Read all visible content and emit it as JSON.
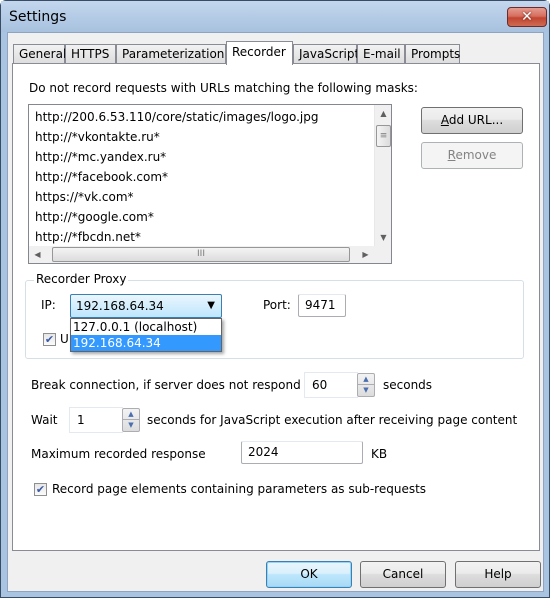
{
  "window": {
    "title": "Settings",
    "close_glyph": "✕"
  },
  "tabs": [
    {
      "label": "General",
      "active": false
    },
    {
      "label": "HTTPS",
      "active": false
    },
    {
      "label": "Parameterization",
      "active": false
    },
    {
      "label": "Recorder",
      "active": true
    },
    {
      "label": "JavaScript",
      "active": false
    },
    {
      "label": "E-mail",
      "active": false
    },
    {
      "label": "Prompts",
      "active": false
    }
  ],
  "recorder": {
    "masks_label": "Do not record requests with URLs matching the following masks:",
    "masks": [
      "http://200.6.53.110/core/static/images/logo.jpg",
      "http://*vkontakte.ru*",
      "http://*mc.yandex.ru*",
      "http://*facebook.com*",
      "https://*vk.com*",
      "http://*google.com*",
      "http://*fbcdn.net*"
    ],
    "add_url_button": {
      "accel": "A",
      "rest": "dd URL..."
    },
    "remove_button": {
      "accel": "R",
      "rest": "emove",
      "disabled": true
    },
    "proxy": {
      "group_title": "Recorder Proxy",
      "ip_label": "IP:",
      "ip_value": "192.168.64.34",
      "ip_options": [
        "127.0.0.1 (localhost)",
        "192.168.64.34"
      ],
      "ip_selected_index": 1,
      "port_label": "Port:",
      "port_value": "9471",
      "use_checkbox_checked": true,
      "use_checkbox_visible_label": "U"
    },
    "break_connection": {
      "label": "Break connection, if server does not respond",
      "value": "60",
      "unit": "seconds"
    },
    "wait": {
      "label": "Wait",
      "value": "1",
      "suffix": "seconds for JavaScript execution after receiving page content"
    },
    "max_response": {
      "label": "Maximum recorded response",
      "value": "2024",
      "unit": "KB"
    },
    "record_sub_requests": {
      "checked": true,
      "label": "Record page elements containing parameters as sub-requests"
    }
  },
  "footer": {
    "ok": "OK",
    "cancel": "Cancel",
    "help": "Help"
  },
  "glyphs": {
    "check": "✔",
    "caret_down": "▼",
    "arrow_up": "▲",
    "arrow_down": "▼",
    "arrow_left": "◀",
    "arrow_right": "▶",
    "grip_v": "≡",
    "grip_h": "III"
  }
}
